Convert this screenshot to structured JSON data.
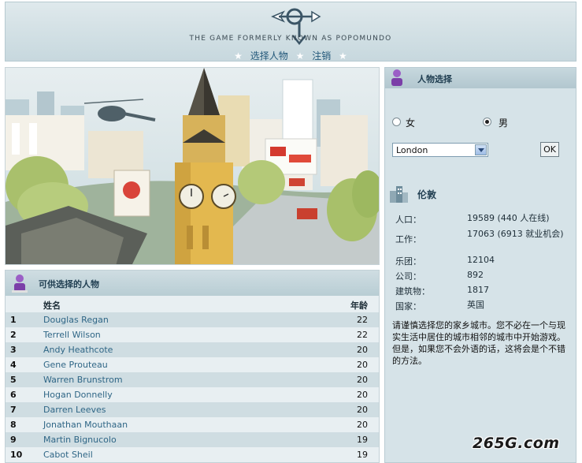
{
  "header": {
    "tagline": "THE GAME FORMERLY KNOWN AS POPOMUNDO",
    "nav": [
      {
        "label": "选择人物"
      },
      {
        "label": "注销"
      }
    ]
  },
  "characters": {
    "title": "可供选择的人物",
    "col_name": "姓名",
    "col_age": "年龄",
    "rows": [
      {
        "num": "1",
        "name": "Douglas Regan",
        "age": "22"
      },
      {
        "num": "2",
        "name": "Terrell Wilson",
        "age": "22"
      },
      {
        "num": "3",
        "name": "Andy Heathcote",
        "age": "20"
      },
      {
        "num": "4",
        "name": "Gene Prouteau",
        "age": "20"
      },
      {
        "num": "5",
        "name": "Warren Brunstrom",
        "age": "20"
      },
      {
        "num": "6",
        "name": "Hogan Donnelly",
        "age": "20"
      },
      {
        "num": "7",
        "name": "Darren Leeves",
        "age": "20"
      },
      {
        "num": "8",
        "name": "Jonathan Mouthaan",
        "age": "20"
      },
      {
        "num": "9",
        "name": "Martin Bignucolo",
        "age": "19"
      },
      {
        "num": "10",
        "name": "Cabot Sheil",
        "age": "19"
      }
    ]
  },
  "select_panel": {
    "title": "人物选择",
    "female": "女",
    "male": "男",
    "selected_gender": "male",
    "city_value": "London",
    "ok": "OK"
  },
  "city": {
    "title": "伦敦",
    "stats": [
      {
        "k": "人口：",
        "v": "19589 (440 人在线)"
      },
      {
        "k": "工作：",
        "v": "17063 (6913 就业机会)"
      },
      {
        "k": "乐团：",
        "v": "12104"
      },
      {
        "k": "公司：",
        "v": "892"
      },
      {
        "k": "建筑物：",
        "v": "1817"
      },
      {
        "k": "国家：",
        "v": "英国"
      }
    ],
    "description": "请谨慎选择您的家乡城市。您不必在一个与现实生活中居住的城市相邻的城市中开始游戏。但是，如果您不会外语的话，这将会是个不错的方法。"
  },
  "watermark": "265G.com",
  "colors": {
    "accent": "#2f6686",
    "panel": "#d6e3e8",
    "row_alt": "#cfdde2"
  }
}
